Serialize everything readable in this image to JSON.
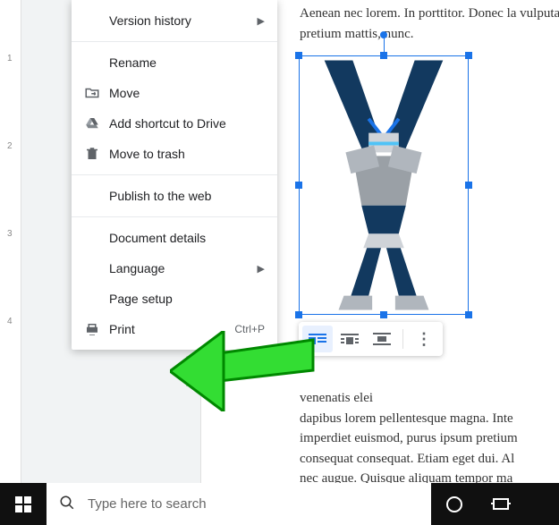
{
  "ruler": {
    "marks": [
      "1",
      "2",
      "3",
      "4"
    ]
  },
  "menu": {
    "version_history": "Version history",
    "rename": "Rename",
    "move": "Move",
    "add_shortcut": "Add shortcut to Drive",
    "trash": "Move to trash",
    "publish": "Publish to the web",
    "details": "Document details",
    "language": "Language",
    "page_setup": "Page setup",
    "print": "Print",
    "print_shortcut": "Ctrl+P"
  },
  "doc": {
    "top_text": "Aenean nec lorem. In porttitor. Donec la vulputate vitae, pretium mattis, nunc.",
    "bottom_text": "venenatis elei\ndapibus lorem pellentesque magna. Inte\nimperdiet euismod, purus ipsum pretium\nconsequat consequat. Etiam eget dui. Al\nnec augue. Quisque aliquam tempor ma"
  },
  "image_toolbar": {
    "opt1": "inline",
    "opt2": "wrap",
    "opt3": "break",
    "more": "more"
  },
  "taskbar": {
    "search_placeholder": "Type here to search"
  }
}
